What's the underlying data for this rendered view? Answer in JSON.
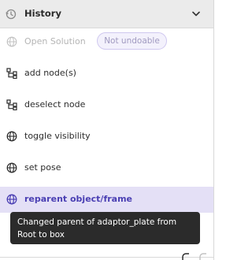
{
  "panel": {
    "title": "History",
    "icons": {
      "header": "history-icon",
      "toggle": "chevron-down-icon"
    }
  },
  "items": [
    {
      "label": "Open Solution",
      "icon": "globe-icon",
      "disabled": true,
      "badge": "Not undoable"
    },
    {
      "label": "add node(s)",
      "icon": "node-tree-icon"
    },
    {
      "label": "deselect node",
      "icon": "node-tree-icon"
    },
    {
      "label": "toggle visibility",
      "icon": "globe-icon"
    },
    {
      "label": "set pose",
      "icon": "globe-icon"
    },
    {
      "label": "reparent object/frame",
      "icon": "globe-icon",
      "selected": true
    }
  ],
  "tooltip": {
    "text": "Changed parent of adaptor_plate from Root to box"
  },
  "colors": {
    "accent": "#4a3fb3",
    "selected_bg": "#e4e0f6",
    "tooltip_bg": "#2b2b2b"
  }
}
